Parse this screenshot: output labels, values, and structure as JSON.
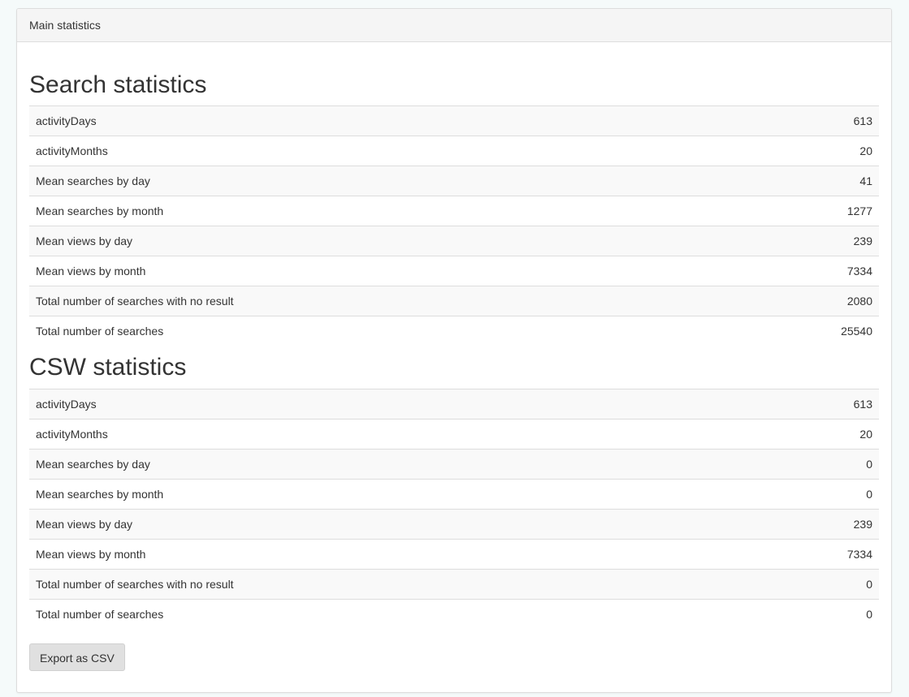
{
  "panel": {
    "heading": "Main statistics"
  },
  "search_statistics": {
    "title": "Search statistics",
    "rows": [
      {
        "label": "activityDays",
        "value": "613"
      },
      {
        "label": "activityMonths",
        "value": "20"
      },
      {
        "label": "Mean searches by day",
        "value": "41"
      },
      {
        "label": "Mean searches by month",
        "value": "1277"
      },
      {
        "label": "Mean views by day",
        "value": "239"
      },
      {
        "label": "Mean views by month",
        "value": "7334"
      },
      {
        "label": "Total number of searches with no result",
        "value": "2080"
      },
      {
        "label": "Total number of searches",
        "value": "25540"
      }
    ]
  },
  "csw_statistics": {
    "title": "CSW statistics",
    "rows": [
      {
        "label": "activityDays",
        "value": "613"
      },
      {
        "label": "activityMonths",
        "value": "20"
      },
      {
        "label": "Mean searches by day",
        "value": "0"
      },
      {
        "label": "Mean searches by month",
        "value": "0"
      },
      {
        "label": "Mean views by day",
        "value": "239"
      },
      {
        "label": "Mean views by month",
        "value": "7334"
      },
      {
        "label": "Total number of searches with no result",
        "value": "0"
      },
      {
        "label": "Total number of searches",
        "value": "0"
      }
    ]
  },
  "actions": {
    "export_label": "Export as CSV"
  }
}
